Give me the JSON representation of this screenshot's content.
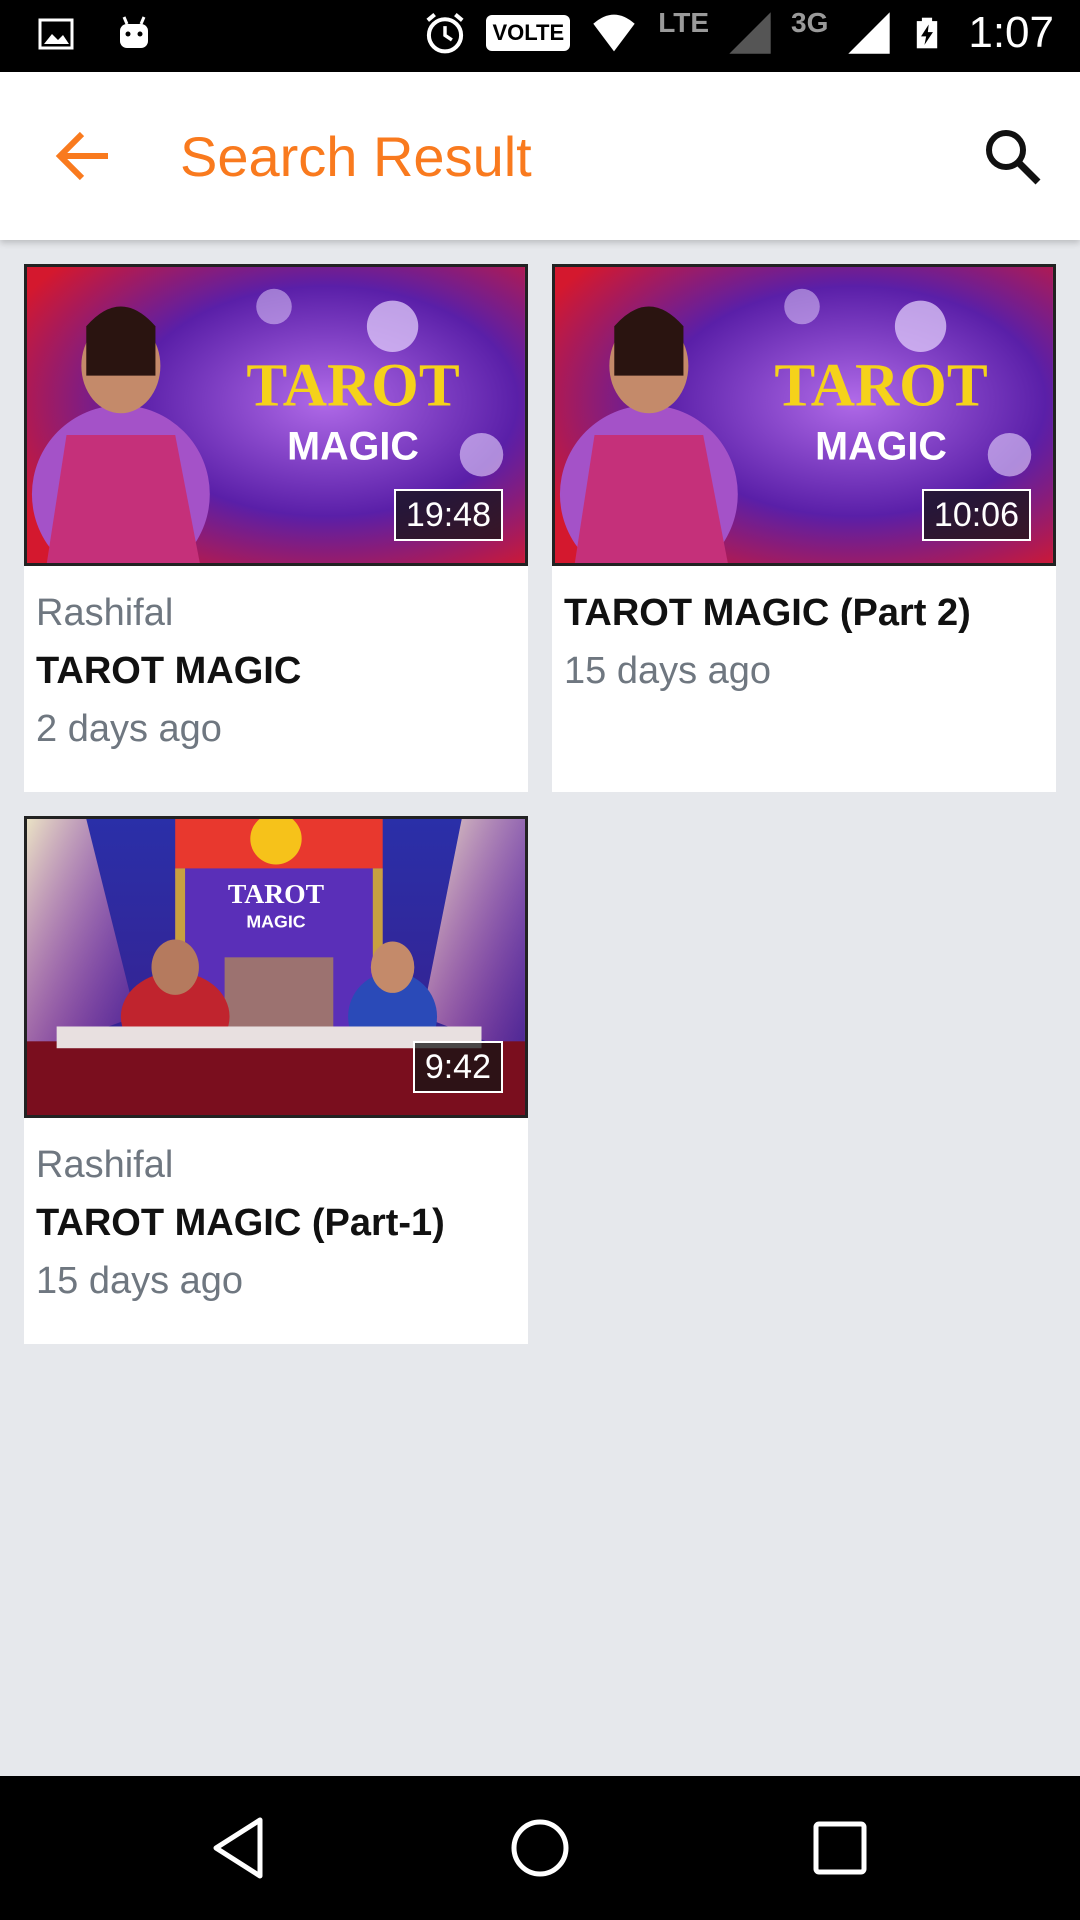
{
  "status_bar": {
    "time": "1:07",
    "volte": "VOLTE",
    "lte": "LTE",
    "net_3g": "3G",
    "icons": [
      "gallery-icon",
      "android-icon",
      "alarm-icon",
      "wifi-icon",
      "signal-icon",
      "battery-charging-icon"
    ]
  },
  "app_bar": {
    "title": "Search Result",
    "back_icon": "arrow-back-icon",
    "search_icon": "search-icon",
    "accent_color": "#f97a1e"
  },
  "videos": [
    {
      "thumbnail_text": [
        "TAROT",
        "MAGIC"
      ],
      "duration": "19:48",
      "channel": "Rashifal",
      "title": "TAROT MAGIC",
      "age": "2 days ago"
    },
    {
      "thumbnail_text": [
        "TAROT",
        "MAGIC"
      ],
      "duration": "10:06",
      "channel": "",
      "title": "TAROT MAGIC (Part 2)",
      "age": "15 days ago"
    },
    {
      "thumbnail_text": [
        "TAROT",
        "MAGIC"
      ],
      "duration": "9:42",
      "channel": "Rashifal",
      "title": "TAROT MAGIC (Part-1)",
      "age": "15 days ago"
    }
  ],
  "nav_bar": {
    "icons": [
      "back-triangle-icon",
      "home-circle-icon",
      "recents-square-icon"
    ]
  }
}
